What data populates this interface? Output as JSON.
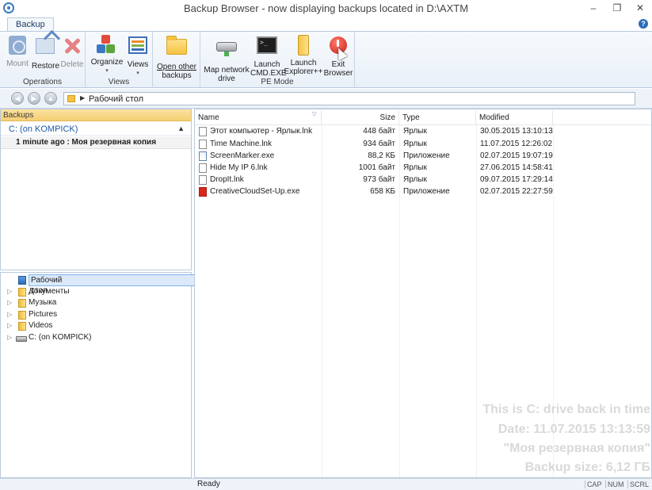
{
  "window": {
    "title": "Backup Browser - now displaying backups located in D:\\AXTM",
    "controls": {
      "minimize": "–",
      "restore": "❐",
      "close": "✕"
    }
  },
  "ribbon": {
    "tabs": [
      {
        "label": "Backup"
      }
    ],
    "help": "?",
    "groups": {
      "operations": {
        "label": "Operations",
        "mount": "Mount",
        "restore": "Restore",
        "delete": "Delete"
      },
      "views": {
        "label": "Views",
        "organize": "Organize",
        "views": "Views"
      },
      "other": {
        "open_other_line1": "Open other",
        "open_other_line2": "backups"
      },
      "pe_mode": {
        "label": "PE Mode",
        "map_network_line1": "Map network",
        "map_network_line2": "drive",
        "launch_cmd_line1": "Launch",
        "launch_cmd_line2": "CMD.EXE",
        "launch_explorer_line1": "Launch",
        "launch_explorer_line2": "Explorer++",
        "exit_line1": "Exit",
        "exit_line2": "Browser"
      }
    },
    "dropdown_glyph": "▾"
  },
  "address": {
    "path": "Рабочий стол",
    "separator": "▶",
    "back": "◀",
    "forward": "▶",
    "up": "▲"
  },
  "backups_pane": {
    "header": "Backups",
    "drive": "C: (on KOMPICK)",
    "collapse": "▲",
    "entry": "1 minute ago : Моя резервная копия"
  },
  "tree": {
    "expand_glyph": "▷",
    "items": [
      {
        "label": "Рабочий стол",
        "selected": true
      },
      {
        "label": "Документы"
      },
      {
        "label": "Музыка"
      },
      {
        "label": "Pictures"
      },
      {
        "label": "Videos"
      },
      {
        "label": "C: (on KOMPICK)"
      }
    ]
  },
  "file_list": {
    "columns": {
      "name": "Name",
      "size": "Size",
      "type": "Type",
      "modified": "Modified"
    },
    "sort_glyph": "▽",
    "rows": [
      {
        "name": "Этот компьютер - Ярлык.lnk",
        "size": "448 байт",
        "type": "Ярлык",
        "modified": "30.05.2015 13:10:13",
        "icon": "shortcut-icon"
      },
      {
        "name": "Time Machine.lnk",
        "size": "934 байт",
        "type": "Ярлык",
        "modified": "11.07.2015 12:26:02",
        "icon": "shortcut-icon"
      },
      {
        "name": "ScreenMarker.exe",
        "size": "88,2 КБ",
        "type": "Приложение",
        "modified": "02.07.2015 19:07:19",
        "icon": "exe-icon"
      },
      {
        "name": "Hide My IP 6.lnk",
        "size": "1001 байт",
        "type": "Ярлык",
        "modified": "27.06.2015 14:58:41",
        "icon": "shortcut-icon"
      },
      {
        "name": "DropIt.lnk",
        "size": "973 байт",
        "type": "Ярлык",
        "modified": "09.07.2015 17:29:14",
        "icon": "shortcut-icon"
      },
      {
        "name": "CreativeCloudSet-Up.exe",
        "size": "658 КБ",
        "type": "Приложение",
        "modified": "02.07.2015 22:27:59",
        "icon": "creative-cloud-icon"
      }
    ]
  },
  "watermark": {
    "line1": "This is C: drive back in time",
    "line2": "Date: 11.07.2015 13:13:59",
    "line3": "\"Моя резервная копия\"",
    "line4": "Backup size: 6,12 ГБ"
  },
  "status": {
    "text": "Ready",
    "cap": "CAP",
    "num": "NUM",
    "scrl": "SCRL"
  },
  "cmd_icon_text": ">_"
}
